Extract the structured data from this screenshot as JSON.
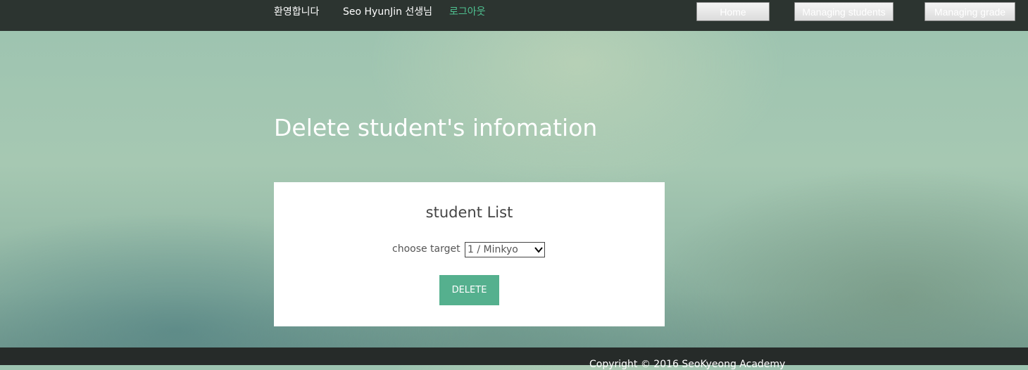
{
  "header": {
    "welcome": "환영합니다",
    "user_name": "Seo HyunJin 선생님",
    "logout": "로그아웃",
    "logout_color": "#4fc291",
    "nav": {
      "home": "Home",
      "managing_students": "Managing students",
      "managing_grade": "Managing grade"
    }
  },
  "main": {
    "page_title": "Delete student's infomation",
    "card": {
      "title": "student List",
      "choose_label": "choose target",
      "select_value": "1 / Minkyo",
      "select_icon": "chevron-down-icon",
      "delete_button": "DELETE",
      "delete_color": "#55b08e"
    }
  },
  "footer": {
    "copyright": "Copyright © 2016 SeoKyeong Academy"
  }
}
